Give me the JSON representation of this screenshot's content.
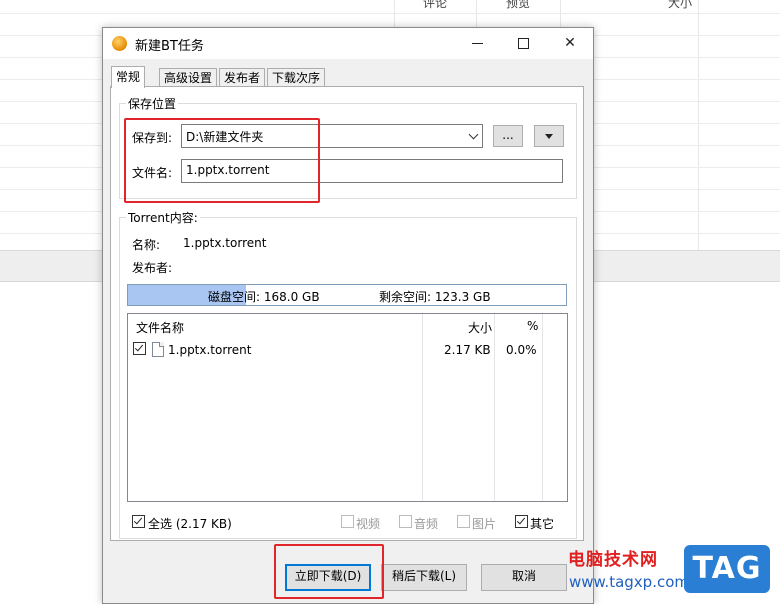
{
  "background_app": {
    "column_headers": [
      "评论",
      "预览",
      "大小"
    ]
  },
  "dialog": {
    "title": "新建BT任务",
    "tabs": [
      "常规",
      "高级设置",
      "发布者",
      "下载次序"
    ],
    "save_group": {
      "title": "保存位置",
      "save_to_label": "保存到:",
      "save_to_value": "D:\\新建文件夹",
      "browse_label": "...",
      "file_name_label": "文件名:",
      "file_name_value": "1.pptx.torrent"
    },
    "torrent_group": {
      "title": "Torrent内容:",
      "name_label": "名称:",
      "name_value": "1.pptx.torrent",
      "publisher_label": "发布者:",
      "publisher_value": ""
    },
    "disk": {
      "disk_space_text": "磁盘空间: 168.0 GB",
      "free_space_text": "剩余空间: 123.3 GB",
      "used_fraction": 0.27
    },
    "file_table": {
      "headers": {
        "name": "文件名称",
        "size": "大小",
        "percent": "%"
      },
      "rows": [
        {
          "name": "1.pptx.torrent",
          "size": "2.17 KB",
          "percent": "0.0%",
          "checked": true
        }
      ]
    },
    "filters": {
      "select_all": "全选 (2.17 KB)",
      "video": "视频",
      "audio": "音频",
      "image": "图片",
      "other": "其它"
    },
    "buttons": {
      "download_now": "立即下载(D)",
      "download_later": "稍后下载(L)",
      "cancel": "取消"
    }
  },
  "watermark": {
    "line1": "电脑技术网",
    "line2": "www.tagxp.com",
    "tag": "TAG"
  },
  "colors": {
    "highlight_box": "#e0262b",
    "disk_fill": "#a9c6f2",
    "tag_blue": "#2a7fd4"
  }
}
